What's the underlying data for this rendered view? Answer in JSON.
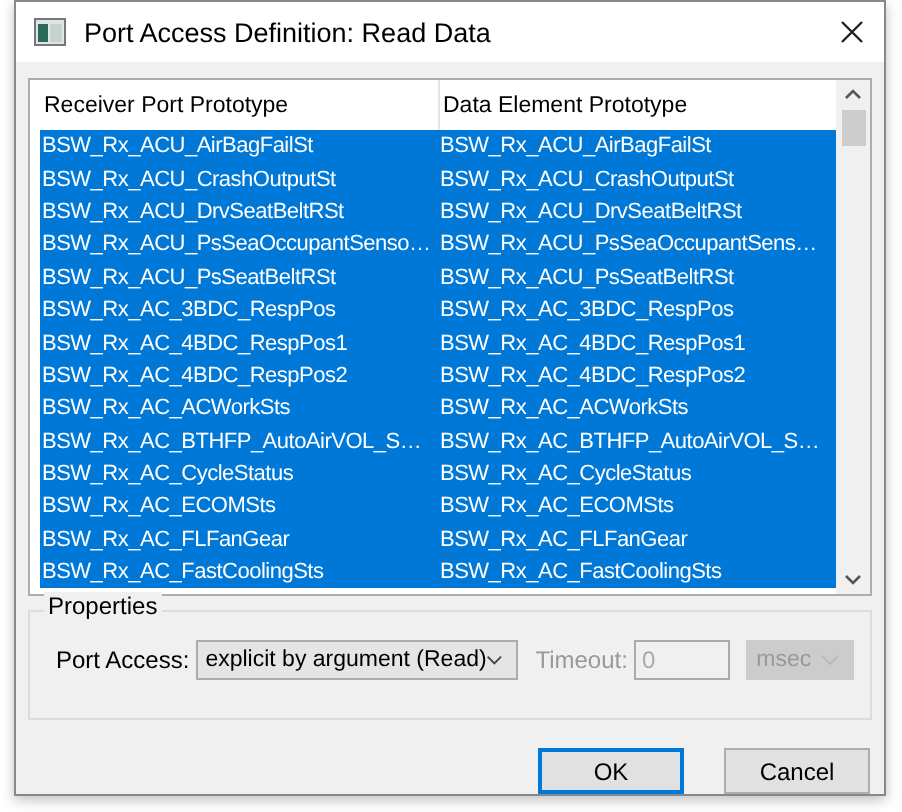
{
  "window": {
    "title": "Port Access Definition: Read Data"
  },
  "table": {
    "columns": [
      "Receiver Port Prototype",
      "Data Element Prototype"
    ],
    "rows": [
      {
        "cells": [
          "BSW_Rx_ACU_AirBagFailSt",
          "BSW_Rx_ACU_AirBagFailSt"
        ],
        "selected": true
      },
      {
        "cells": [
          "BSW_Rx_ACU_CrashOutputSt",
          "BSW_Rx_ACU_CrashOutputSt"
        ],
        "selected": true
      },
      {
        "cells": [
          "BSW_Rx_ACU_DrvSeatBeltRSt",
          "BSW_Rx_ACU_DrvSeatBeltRSt"
        ],
        "selected": true
      },
      {
        "cells": [
          "BSW_Rx_ACU_PsSeaOccupantSenso…",
          "BSW_Rx_ACU_PsSeaOccupantSens…"
        ],
        "selected": true
      },
      {
        "cells": [
          "BSW_Rx_ACU_PsSeatBeltRSt",
          "BSW_Rx_ACU_PsSeatBeltRSt"
        ],
        "selected": true
      },
      {
        "cells": [
          "BSW_Rx_AC_3BDC_RespPos",
          "BSW_Rx_AC_3BDC_RespPos"
        ],
        "selected": true
      },
      {
        "cells": [
          "BSW_Rx_AC_4BDC_RespPos1",
          "BSW_Rx_AC_4BDC_RespPos1"
        ],
        "selected": true
      },
      {
        "cells": [
          "BSW_Rx_AC_4BDC_RespPos2",
          "BSW_Rx_AC_4BDC_RespPos2"
        ],
        "selected": true
      },
      {
        "cells": [
          "BSW_Rx_AC_ACWorkSts",
          "BSW_Rx_AC_ACWorkSts"
        ],
        "selected": true
      },
      {
        "cells": [
          "BSW_Rx_AC_BTHFP_AutoAirVOL_S…",
          "BSW_Rx_AC_BTHFP_AutoAirVOL_S…"
        ],
        "selected": true
      },
      {
        "cells": [
          "BSW_Rx_AC_CycleStatus",
          "BSW_Rx_AC_CycleStatus"
        ],
        "selected": true
      },
      {
        "cells": [
          "BSW_Rx_AC_ECOMSts",
          "BSW_Rx_AC_ECOMSts"
        ],
        "selected": true
      },
      {
        "cells": [
          "BSW_Rx_AC_FLFanGear",
          "BSW_Rx_AC_FLFanGear"
        ],
        "selected": true
      },
      {
        "cells": [
          "BSW_Rx_AC_FastCoolingSts",
          "BSW_Rx_AC_FastCoolingSts"
        ],
        "selected": true
      }
    ]
  },
  "properties": {
    "title": "Properties",
    "port_access_label": "Port Access:",
    "port_access_value": "explicit by argument (Read)",
    "timeout_label": "Timeout:",
    "timeout_value": "0",
    "timeout_disabled": true,
    "unit_value": "msec",
    "unit_disabled": true
  },
  "buttons": [
    {
      "label": "OK",
      "default": true
    },
    {
      "label": "Cancel",
      "default": false
    }
  ]
}
